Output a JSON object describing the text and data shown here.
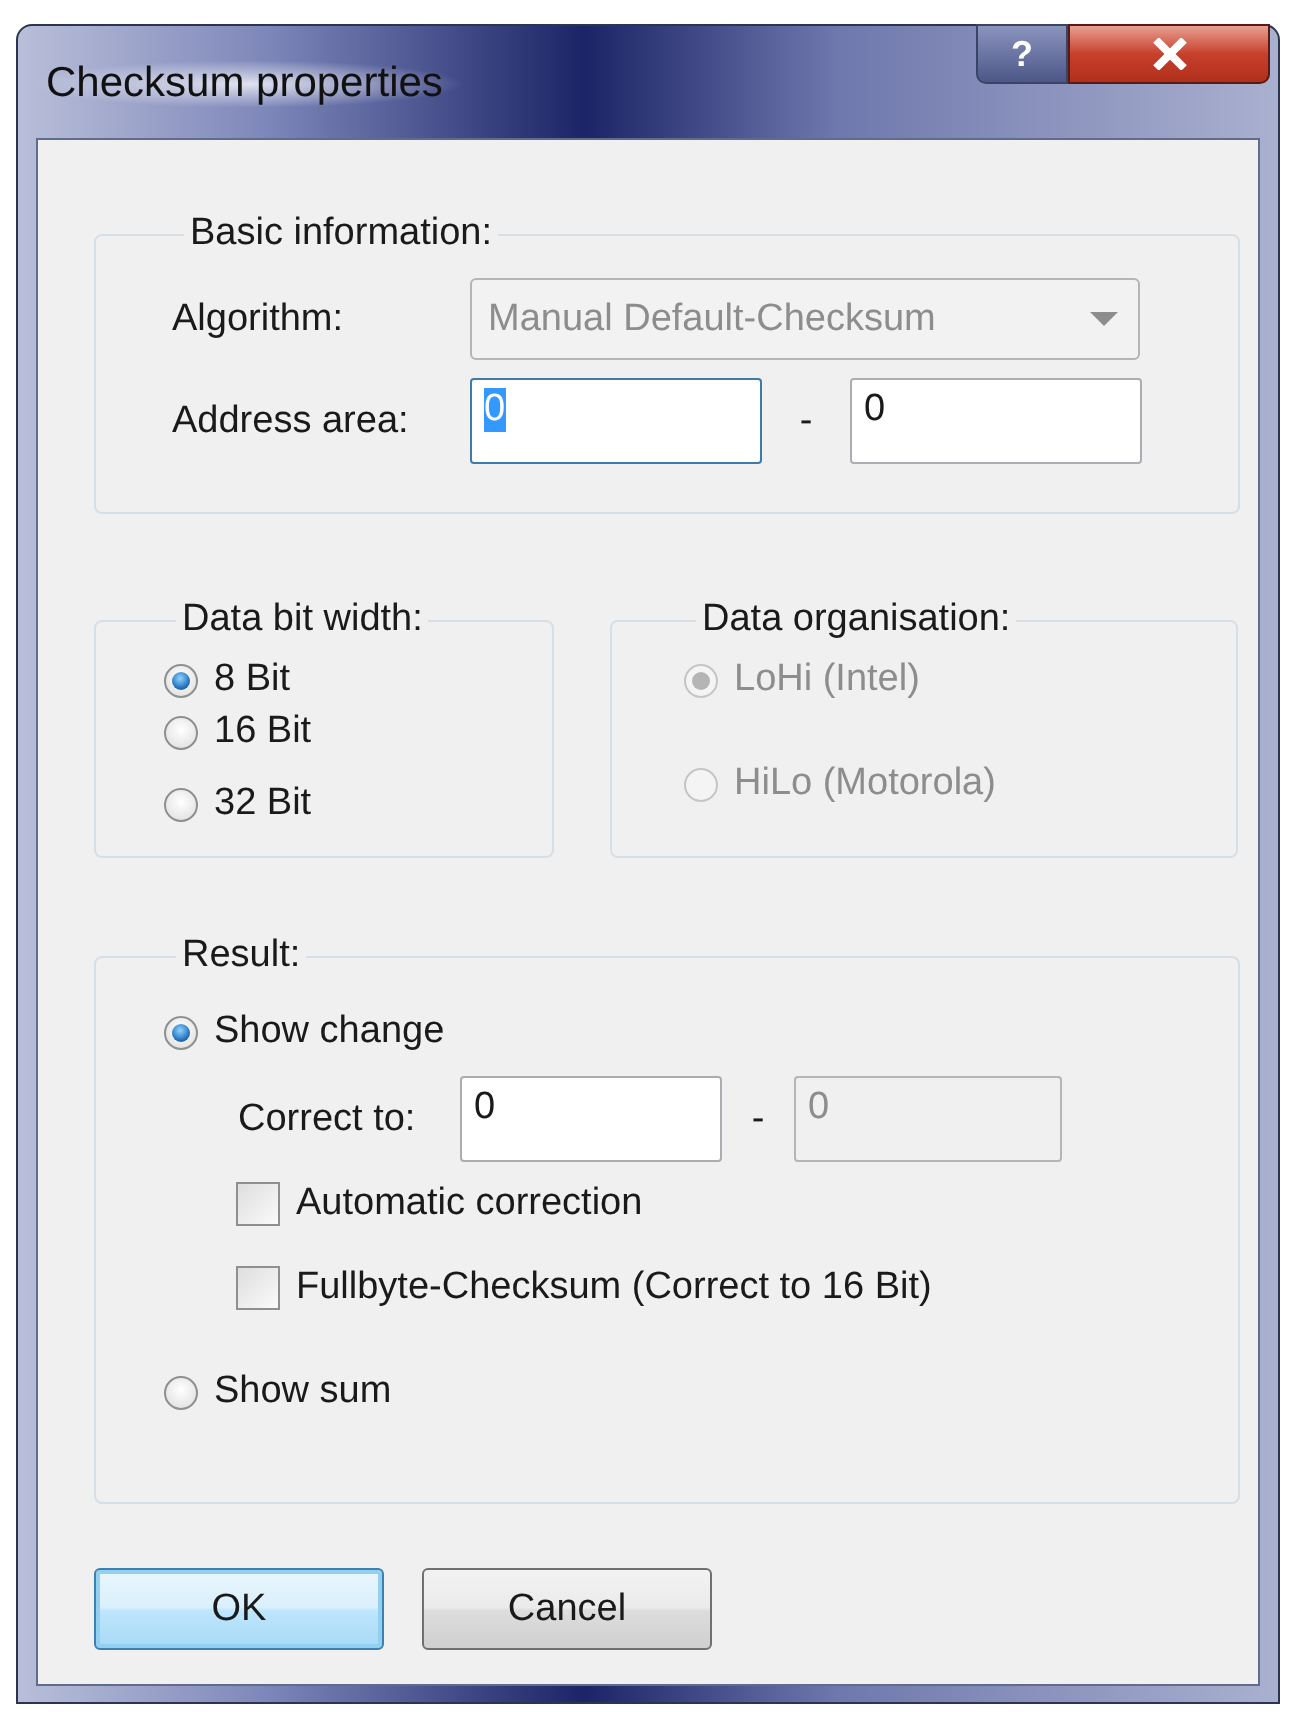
{
  "window": {
    "title": "Checksum properties",
    "help_button": "?"
  },
  "basic_information": {
    "title": "Basic information:",
    "algorithm": {
      "label": "Algorithm:",
      "value": "Manual Default-Checksum",
      "disabled": true
    },
    "address_area": {
      "label": "Address area:",
      "from": {
        "value": "0",
        "focused": true
      },
      "separator": "-",
      "to": {
        "value": "0",
        "focused": false
      }
    }
  },
  "data_bit_width": {
    "title": "Data bit width:",
    "disabled": false,
    "options": [
      {
        "label": "8 Bit",
        "selected": true
      },
      {
        "label": "16 Bit",
        "selected": false
      },
      {
        "label": "32 Bit",
        "selected": false
      }
    ]
  },
  "data_organisation": {
    "title": "Data organisation:",
    "disabled": true,
    "options": [
      {
        "label": "LoHi (Intel)",
        "selected": true
      },
      {
        "label": "HiLo (Motorola)",
        "selected": false
      }
    ]
  },
  "result": {
    "title": "Result:",
    "show_change": {
      "label": "Show change",
      "selected": true
    },
    "correct_to": {
      "label": "Correct to:",
      "from": {
        "value": "0",
        "disabled": false
      },
      "separator": "-",
      "to": {
        "value": "0",
        "disabled": true
      }
    },
    "checkboxes": [
      {
        "label": "Automatic correction",
        "checked": false
      },
      {
        "label": "Fullbyte-Checksum (Correct to 16 Bit)",
        "checked": false
      }
    ],
    "show_sum": {
      "label": "Show sum",
      "selected": false
    }
  },
  "buttons": [
    {
      "label": "OK",
      "default": true
    },
    {
      "label": "Cancel",
      "default": false
    }
  ]
}
